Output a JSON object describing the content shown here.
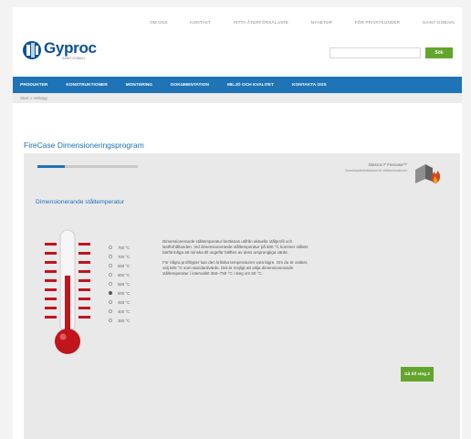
{
  "top_links": [
    "Om Oss",
    "Kontakt",
    "Hitta återförsäljare",
    "Nyheter",
    "För privatkunder",
    "Saint-Gobain"
  ],
  "logo": {
    "name": "Gyproc",
    "tagline": "SAINT-GOBAIN"
  },
  "search": {
    "placeholder": "",
    "button_label": "Sök"
  },
  "nav": [
    "Produkter",
    "Konstruktioner",
    "Montering",
    "Dokumentation",
    "Miljö och kvalitet",
    "Kontakta oss"
  ],
  "breadcrumb": "Start > Verktyg",
  "page_title": "FireCase Dimensioneringsprogram",
  "progress": {
    "fraction": 0.27
  },
  "brand": {
    "title": "Glasroc F Firecase™",
    "subtitle": "Brandskyddsbeklädnad för stålkonstruktioner"
  },
  "step_title": "Dimensionerande ståltemperatur",
  "temperatures": [
    "750 °C",
    "700 °C",
    "650 °C",
    "600 °C",
    "550 °C",
    "500 °C",
    "450 °C",
    "400 °C",
    "350 °C"
  ],
  "selected_temperature_index": 5,
  "description": [
    "Dimensionerande ståltemperatur beräknas utifrån aktuella stålprofil och lastförhållanden. Vid dimensionerande ståltemperatur på 500 °C kommer stålets bärförmåga att minska till ungefär hälften av dess ursprungliga värde.",
    "För några profiltyper kan den kritiska temperaturen vara lägre. Om du är osäker, välj 500 °C som standardvärde. Det är möjligt att välja dimensionerande ståltemperatur i intervallet 350–750 °C i steg om 50 °C."
  ],
  "next_button_label": "Gå till steg 2",
  "colors": {
    "brand_blue": "#1f73b7",
    "accent_green": "#62a52c",
    "thermometer_red": "#c0151d"
  }
}
